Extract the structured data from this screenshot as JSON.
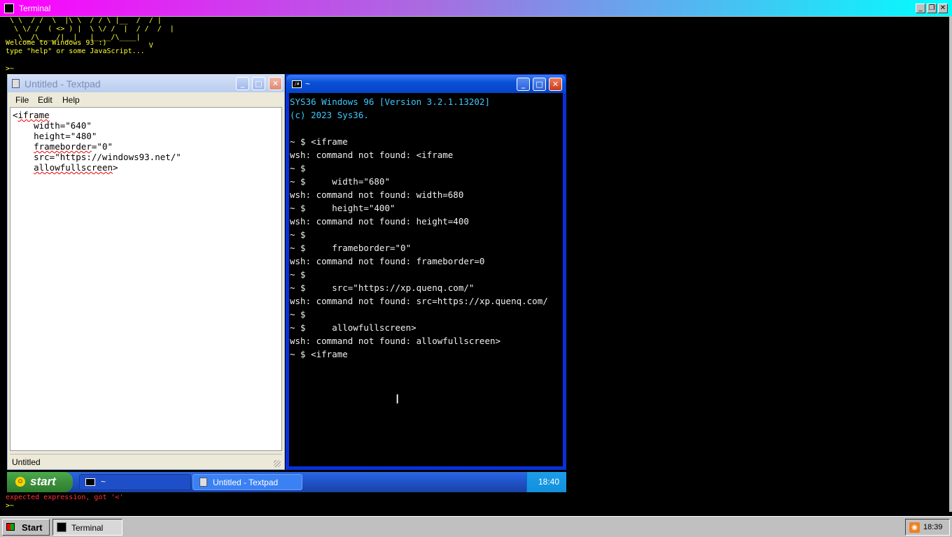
{
  "outer_window": {
    "title": "Terminal",
    "ascii_art": " \\ \\  / /  \\  |\\ \\  / / \\ |__  /  / |\n  \\ \\/ /  ( <> ) |  \\ \\/ /  |  / /  /  |\n   \\__/\\____/|__|   |____/\\____|\n                                  V",
    "welcome_text": "Welcome to Windows 93 :)\ntype \"help\" or some JavaScript...",
    "prompt": ">~",
    "error_text": "expected expression, got '<'",
    "prompt2": ">~"
  },
  "outer_taskbar": {
    "start_label": "Start",
    "task_terminal": "Terminal",
    "clock": "18:39"
  },
  "textpad": {
    "title": "Untitled - Textpad",
    "menu": [
      "File",
      "Edit",
      "Help"
    ],
    "content": {
      "l1_a": "<",
      "l1_b": "iframe",
      "l2_a": "    width=\"640\"",
      "l3_a": "    height=\"480\"",
      "l4_a": "    ",
      "l4_b": "frameborder",
      "l4_c": "=\"0\"",
      "l5_a": "    src=\"https://windows93.net/\"",
      "l6_a": "    ",
      "l6_b": "allowfullscreen",
      "l6_c": ">"
    },
    "status": "Untitled"
  },
  "terminal": {
    "title": "~",
    "lines": [
      "SYS36 Windows 96 [Version 3.2.1.13202]",
      "(c) 2023 Sys36.",
      "",
      "~ $ <iframe",
      "wsh: command not found: <iframe",
      "~ $",
      "~ $     width=\"680\"",
      "wsh: command not found: width=680",
      "~ $     height=\"400\"",
      "wsh: command not found: height=400",
      "~ $",
      "~ $     frameborder=\"0\"",
      "wsh: command not found: frameborder=0",
      "~ $",
      "~ $     src=\"https://xp.quenq.com/\"",
      "wsh: command not found: src=https://xp.quenq.com/",
      "~ $",
      "~ $     allowfullscreen>",
      "wsh: command not found: allowfullscreen>",
      "~ $ <iframe"
    ]
  },
  "xp_taskbar": {
    "start_label": "start",
    "task_terminal": "~",
    "task_textpad": "Untitled - Textpad",
    "clock": "18:40"
  },
  "colors": {
    "terminal_cyan": "#3ec8ff",
    "xp_blue": "#0831d9",
    "outer_yellow": "#ffff33",
    "error_red": "#ff3333"
  }
}
